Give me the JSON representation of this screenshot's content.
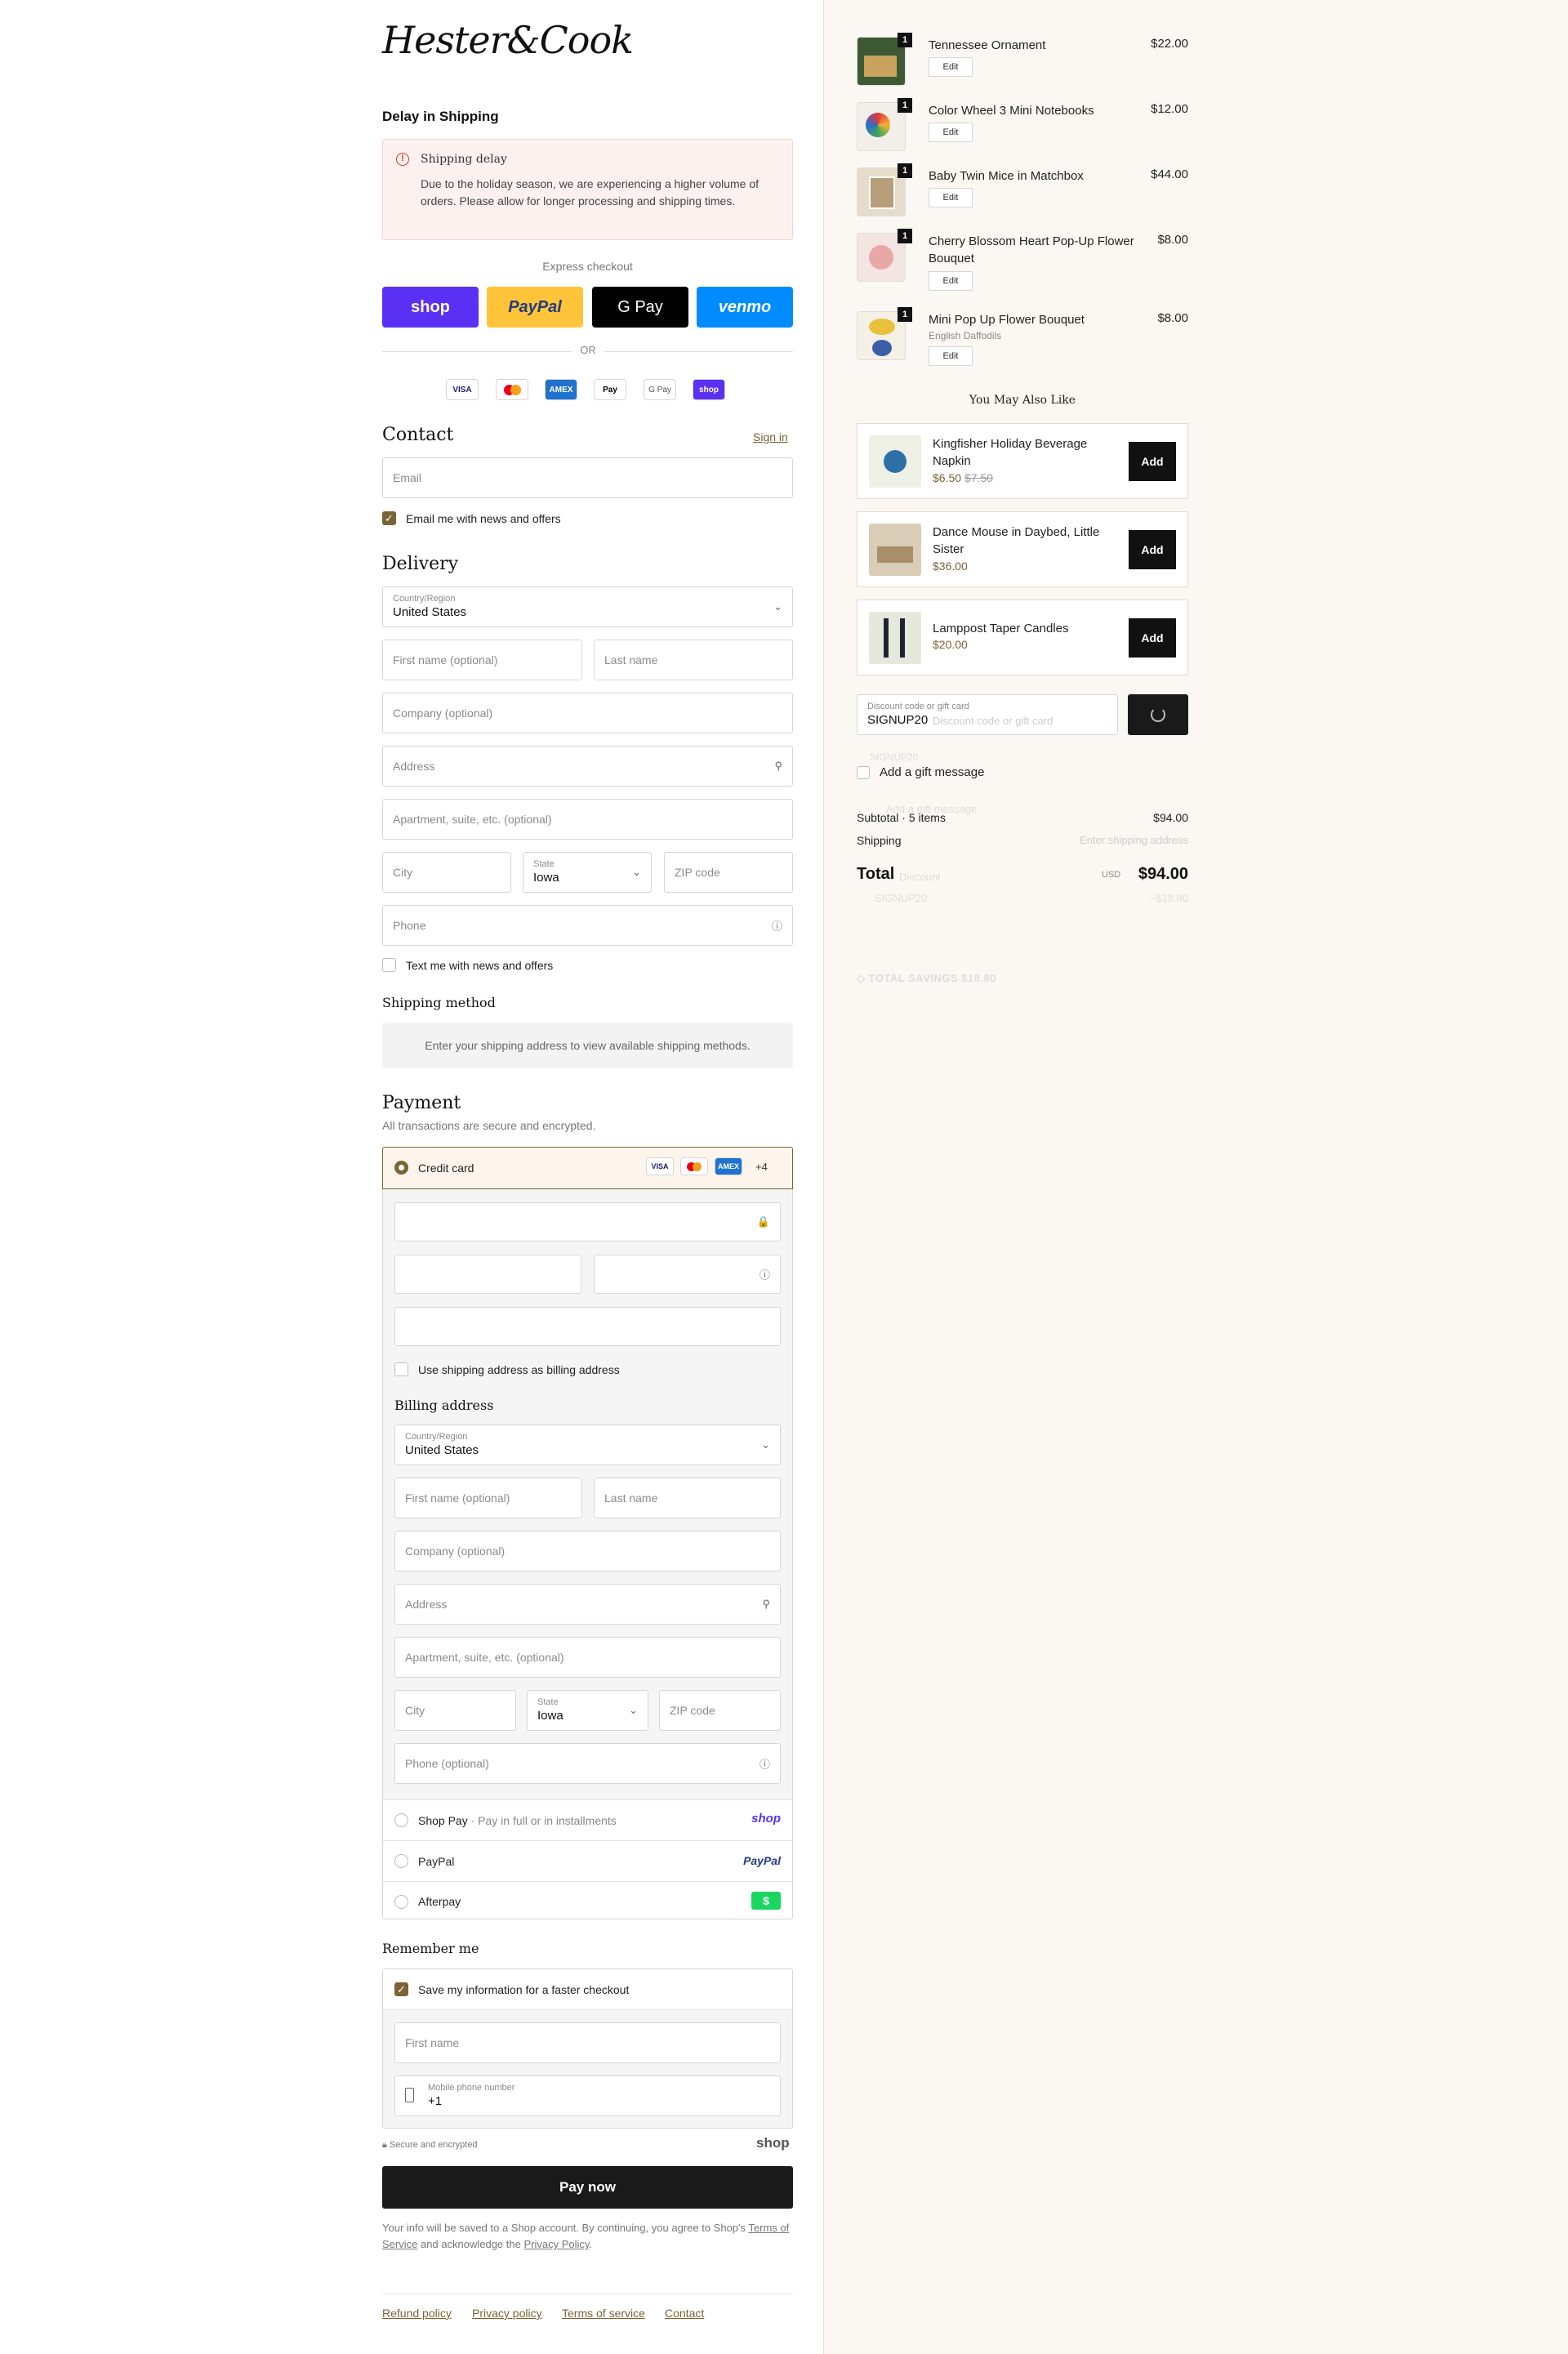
{
  "brand": {
    "logo_text": "Hester&Cook"
  },
  "notice": {
    "heading": "Delay in Shipping",
    "title": "Shipping delay",
    "body": "Due to the holiday season, we are experiencing a higher volume of orders. Please allow for longer processing and shipping times."
  },
  "express": {
    "label": "Express checkout",
    "shop": "shop",
    "paypal": "PayPal",
    "gpay": "G Pay",
    "venmo": "venmo",
    "or": "OR",
    "badges": [
      "VISA",
      "MC",
      "AMEX",
      "Pay",
      "G Pay",
      "shop"
    ]
  },
  "contact": {
    "title": "Contact",
    "signin": "Sign in",
    "email_placeholder": "Email",
    "newsletter": "Email me with news and offers"
  },
  "delivery": {
    "title": "Delivery",
    "country_label": "Country/Region",
    "country_value": "United States",
    "first_name": "First name (optional)",
    "last_name": "Last name",
    "company": "Company (optional)",
    "address": "Address",
    "apartment": "Apartment, suite, etc. (optional)",
    "city": "City",
    "state_label": "State",
    "state_value": "Iowa",
    "zip": "ZIP code",
    "phone": "Phone",
    "text_me": "Text me with news and offers"
  },
  "shipping_method": {
    "title": "Shipping method",
    "message": "Enter your shipping address to view available shipping methods."
  },
  "payment": {
    "title": "Payment",
    "subtitle": "All transactions are secure and encrypted.",
    "credit_card": "Credit card",
    "more_cards": "+4",
    "card_badges": [
      "VISA",
      "MC",
      "AMEX"
    ],
    "use_shipping": "Use shipping address as billing address",
    "billing_title": "Billing address",
    "billing": {
      "country_label": "Country/Region",
      "country_value": "United States",
      "first_name": "First name (optional)",
      "last_name": "Last name",
      "company": "Company (optional)",
      "address": "Address",
      "apartment": "Apartment, suite, etc. (optional)",
      "city": "City",
      "state_label": "State",
      "state_value": "Iowa",
      "zip": "ZIP code",
      "phone": "Phone (optional)"
    },
    "shop_pay": "Shop Pay",
    "shop_pay_sub": " · Pay in full or in installments",
    "shop_pay_logo": "shop",
    "paypal": "PayPal",
    "paypal_logo": "PayPal",
    "afterpay": "Afterpay",
    "afterpay_logo": "$"
  },
  "remember": {
    "title": "Remember me",
    "save_info": "Save my information for a faster checkout",
    "first_name": "First name",
    "mobile_label": "Mobile phone number",
    "mobile_value": "+1",
    "secure": "Secure and encrypted",
    "shop_logo": "shop"
  },
  "pay_now": "Pay now",
  "legal": {
    "prefix": "Your info will be saved to a Shop account. By continuing, you agree to Shop's ",
    "tos": "Terms of Service",
    "middle": " and acknowledge the ",
    "privacy": "Privacy Policy",
    "suffix": "."
  },
  "footer": [
    "Refund policy",
    "Privacy policy",
    "Terms of service",
    "Contact"
  ],
  "cart": {
    "edit_label": "Edit",
    "items": [
      {
        "name": "Tennessee Ornament",
        "price": "$22.00",
        "qty": "1",
        "variant": ""
      },
      {
        "name": "Color Wheel 3 Mini Notebooks",
        "price": "$12.00",
        "qty": "1",
        "variant": ""
      },
      {
        "name": "Baby Twin Mice in Matchbox",
        "price": "$44.00",
        "qty": "1",
        "variant": ""
      },
      {
        "name": "Cherry Blossom Heart Pop-Up Flower Bouquet",
        "price": "$8.00",
        "qty": "1",
        "variant": ""
      },
      {
        "name": "Mini Pop Up Flower Bouquet",
        "price": "$8.00",
        "qty": "1",
        "variant": "English Daffodils"
      }
    ]
  },
  "upsell": {
    "title": "You May Also Like",
    "add_label": "Add",
    "items": [
      {
        "name": "Kingfisher Holiday Beverage Napkin",
        "price": "$6.50",
        "compare": "$7.50"
      },
      {
        "name": "Dance Mouse in Daybed, Little Sister",
        "price": "$36.00",
        "compare": ""
      },
      {
        "name": "Lamppost Taper Candles",
        "price": "$20.00",
        "compare": ""
      }
    ]
  },
  "discount": {
    "label": "Discount code or gift card",
    "value": "SIGNUP20",
    "ghost_placeholder": "Discount code or gift card",
    "ghost_tag": "SIGNUP20"
  },
  "gift": {
    "label": "Add a gift message",
    "ghost": "Add a gift message"
  },
  "summary": {
    "subtotal_label": "Subtotal · 5 items",
    "subtotal_value": "$94.00",
    "shipping_label": "Shipping",
    "shipping_value": "Enter shipping address",
    "total_label": "Total",
    "currency": "USD",
    "total_value": "$94.00",
    "ghost_discount_label": "Discount",
    "ghost_code": "SIGNUP20",
    "ghost_amount": "−$18.80",
    "savings": "TOTAL SAVINGS  $18.80"
  }
}
